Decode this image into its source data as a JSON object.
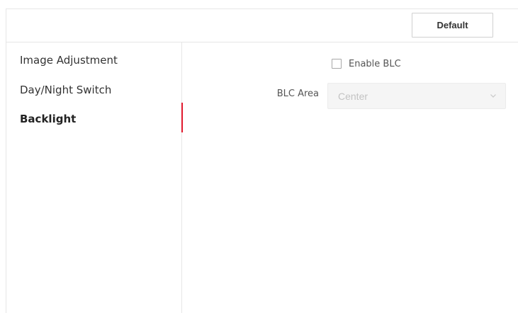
{
  "toolbar": {
    "default_label": "Default"
  },
  "sidebar": {
    "items": [
      {
        "label": "Image Adjustment",
        "active": false
      },
      {
        "label": "Day/Night Switch",
        "active": false
      },
      {
        "label": "Backlight",
        "active": true
      }
    ],
    "active_color": "#e0182d"
  },
  "backlight": {
    "enable_blc": {
      "label": "Enable BLC",
      "checked": false
    },
    "blc_area": {
      "label": "BLC Area",
      "value": "Center",
      "disabled": true,
      "icon": "chevron-down-icon"
    }
  }
}
